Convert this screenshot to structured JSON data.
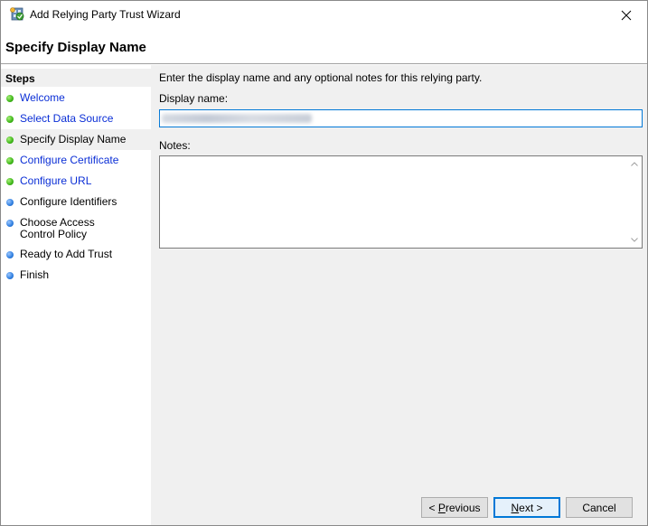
{
  "window": {
    "title": "Add Relying Party Trust Wizard"
  },
  "page": {
    "title": "Specify Display Name"
  },
  "steps": {
    "header": "Steps",
    "items": [
      {
        "label": "Welcome",
        "status": "complete",
        "link": true
      },
      {
        "label": "Select Data Source",
        "status": "complete",
        "link": true
      },
      {
        "label": "Specify Display Name",
        "status": "current",
        "link": false
      },
      {
        "label": "Configure Certificate",
        "status": "complete",
        "link": true
      },
      {
        "label": "Configure URL",
        "status": "complete",
        "link": true
      },
      {
        "label": "Configure Identifiers",
        "status": "pending",
        "link": false
      },
      {
        "label": "Choose Access Control Policy",
        "status": "pending",
        "link": false
      },
      {
        "label": "Ready to Add Trust",
        "status": "pending",
        "link": false
      },
      {
        "label": "Finish",
        "status": "pending",
        "link": false
      }
    ]
  },
  "content": {
    "instruction": "Enter the display name and any optional notes for this relying party.",
    "display_name_label": "Display name:",
    "notes_label": "Notes:"
  },
  "buttons": {
    "previous_prefix": "< ",
    "previous_access": "P",
    "previous_rest": "revious",
    "next_access": "N",
    "next_rest": "ext >",
    "cancel": "Cancel"
  },
  "colors": {
    "accent": "#0078d7",
    "link": "#0a2ed6",
    "complete": "#3db518",
    "pending": "#2f7ee0"
  }
}
